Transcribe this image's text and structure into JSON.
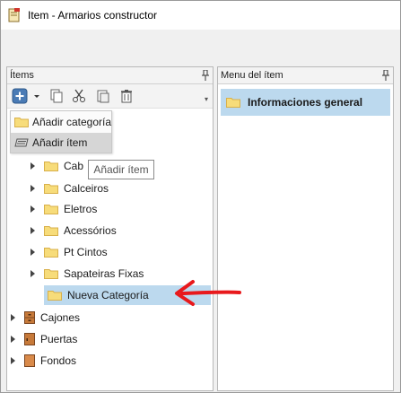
{
  "window": {
    "title": "Item - Armarios constructor"
  },
  "left_panel": {
    "header": "Ítems",
    "toolbar": {
      "add_icon": "plus-square-icon",
      "dropdown_icon": "chevron-down-icon",
      "copy_icon": "copy-icon",
      "cut_icon": "scissors-icon",
      "paste_icon": "paste-icon",
      "delete_icon": "trash-icon"
    },
    "dropdown_menu": {
      "add_category": "Añadir categoría",
      "add_item": "Añadir ítem"
    },
    "tooltip": "Añadir ítem",
    "tree": [
      {
        "label": "Cab",
        "type": "folder",
        "expandable": true
      },
      {
        "label": "Calceiros",
        "type": "folder",
        "expandable": true
      },
      {
        "label": "Eletros",
        "type": "folder",
        "expandable": true
      },
      {
        "label": "Acessórios",
        "type": "folder",
        "expandable": true
      },
      {
        "label": "Pt Cintos",
        "type": "folder",
        "expandable": true
      },
      {
        "label": "Sapateiras Fixas",
        "type": "folder",
        "expandable": true
      },
      {
        "label": "Nueva Categoría",
        "type": "folder",
        "expandable": false,
        "selected": true
      },
      {
        "label": "Cajones",
        "type": "item",
        "expandable": true
      },
      {
        "label": "Puertas",
        "type": "item",
        "expandable": true
      },
      {
        "label": "Fondos",
        "type": "item",
        "expandable": true
      }
    ]
  },
  "right_panel": {
    "header": "Menu del ítem",
    "items": [
      {
        "label": "Informaciones general",
        "selected": true
      }
    ]
  },
  "colors": {
    "selection": "#bcd9ee",
    "folder": "#f7dc7a",
    "folder_border": "#d8b04a",
    "arrow": "#e8191c",
    "add_button": "#3a6ea5",
    "item_icon": "#c77a3a"
  }
}
